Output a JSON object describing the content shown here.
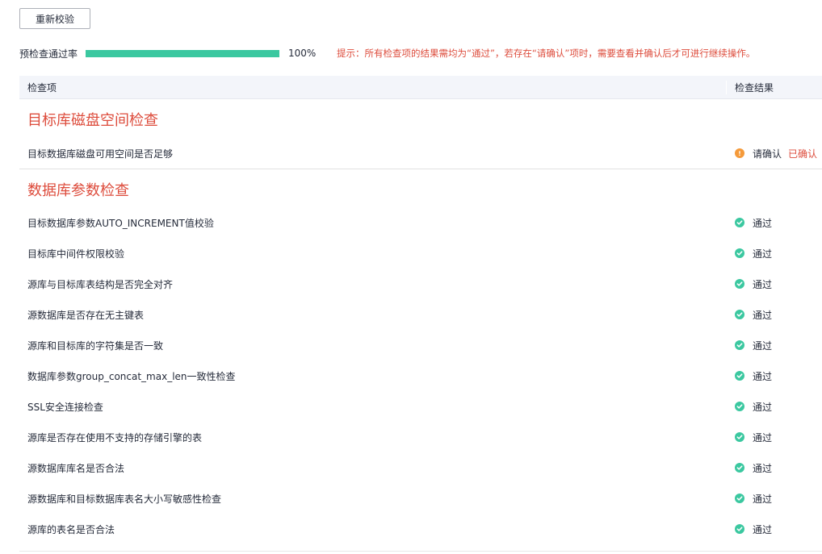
{
  "recheck_button": "重新校验",
  "precheck": {
    "label": "预检查通过率",
    "progress": 1.0,
    "percent_text": "100%",
    "hint": "提示：所有检查项的结果需均为“通过”，若存在“请确认”项时，需要查看并确认后才可进行继续操作。",
    "progress_color": "#3bc8a0"
  },
  "table": {
    "header_item": "检查项",
    "header_result": "检查结果"
  },
  "groups": [
    {
      "title": "目标库磁盘空间检查",
      "rows": [
        {
          "item": "目标数据库磁盘可用空间是否足够",
          "status": "warning",
          "status_text": "请确认",
          "action": "已确认"
        }
      ]
    },
    {
      "title": "数据库参数检查",
      "rows": [
        {
          "item": "目标数据库参数AUTO_INCREMENT值校验",
          "status": "pass",
          "status_text": "通过"
        },
        {
          "item": "目标库中间件权限校验",
          "status": "pass",
          "status_text": "通过"
        },
        {
          "item": "源库与目标库表结构是否完全对齐",
          "status": "pass",
          "status_text": "通过"
        },
        {
          "item": "源数据库是否存在无主键表",
          "status": "pass",
          "status_text": "通过"
        },
        {
          "item": "源库和目标库的字符集是否一致",
          "status": "pass",
          "status_text": "通过"
        },
        {
          "item": "数据库参数group_concat_max_len一致性检查",
          "status": "pass",
          "status_text": "通过"
        },
        {
          "item": "SSL安全连接检查",
          "status": "pass",
          "status_text": "通过"
        },
        {
          "item": "源库是否存在使用不支持的存储引擎的表",
          "status": "pass",
          "status_text": "通过"
        },
        {
          "item": "源数据库库名是否合法",
          "status": "pass",
          "status_text": "通过"
        },
        {
          "item": "源数据库和目标数据库表名大小写敏感性检查",
          "status": "pass",
          "status_text": "通过"
        },
        {
          "item": "源库的表名是否合法",
          "status": "pass",
          "status_text": "通过"
        }
      ]
    }
  ],
  "colors": {
    "pass": "#3bc8a0",
    "warning": "#f59a3a",
    "accent_red": "#dd4c3c"
  },
  "icons": {
    "pass": "check-circle-icon",
    "warning": "exclamation-circle-icon"
  }
}
